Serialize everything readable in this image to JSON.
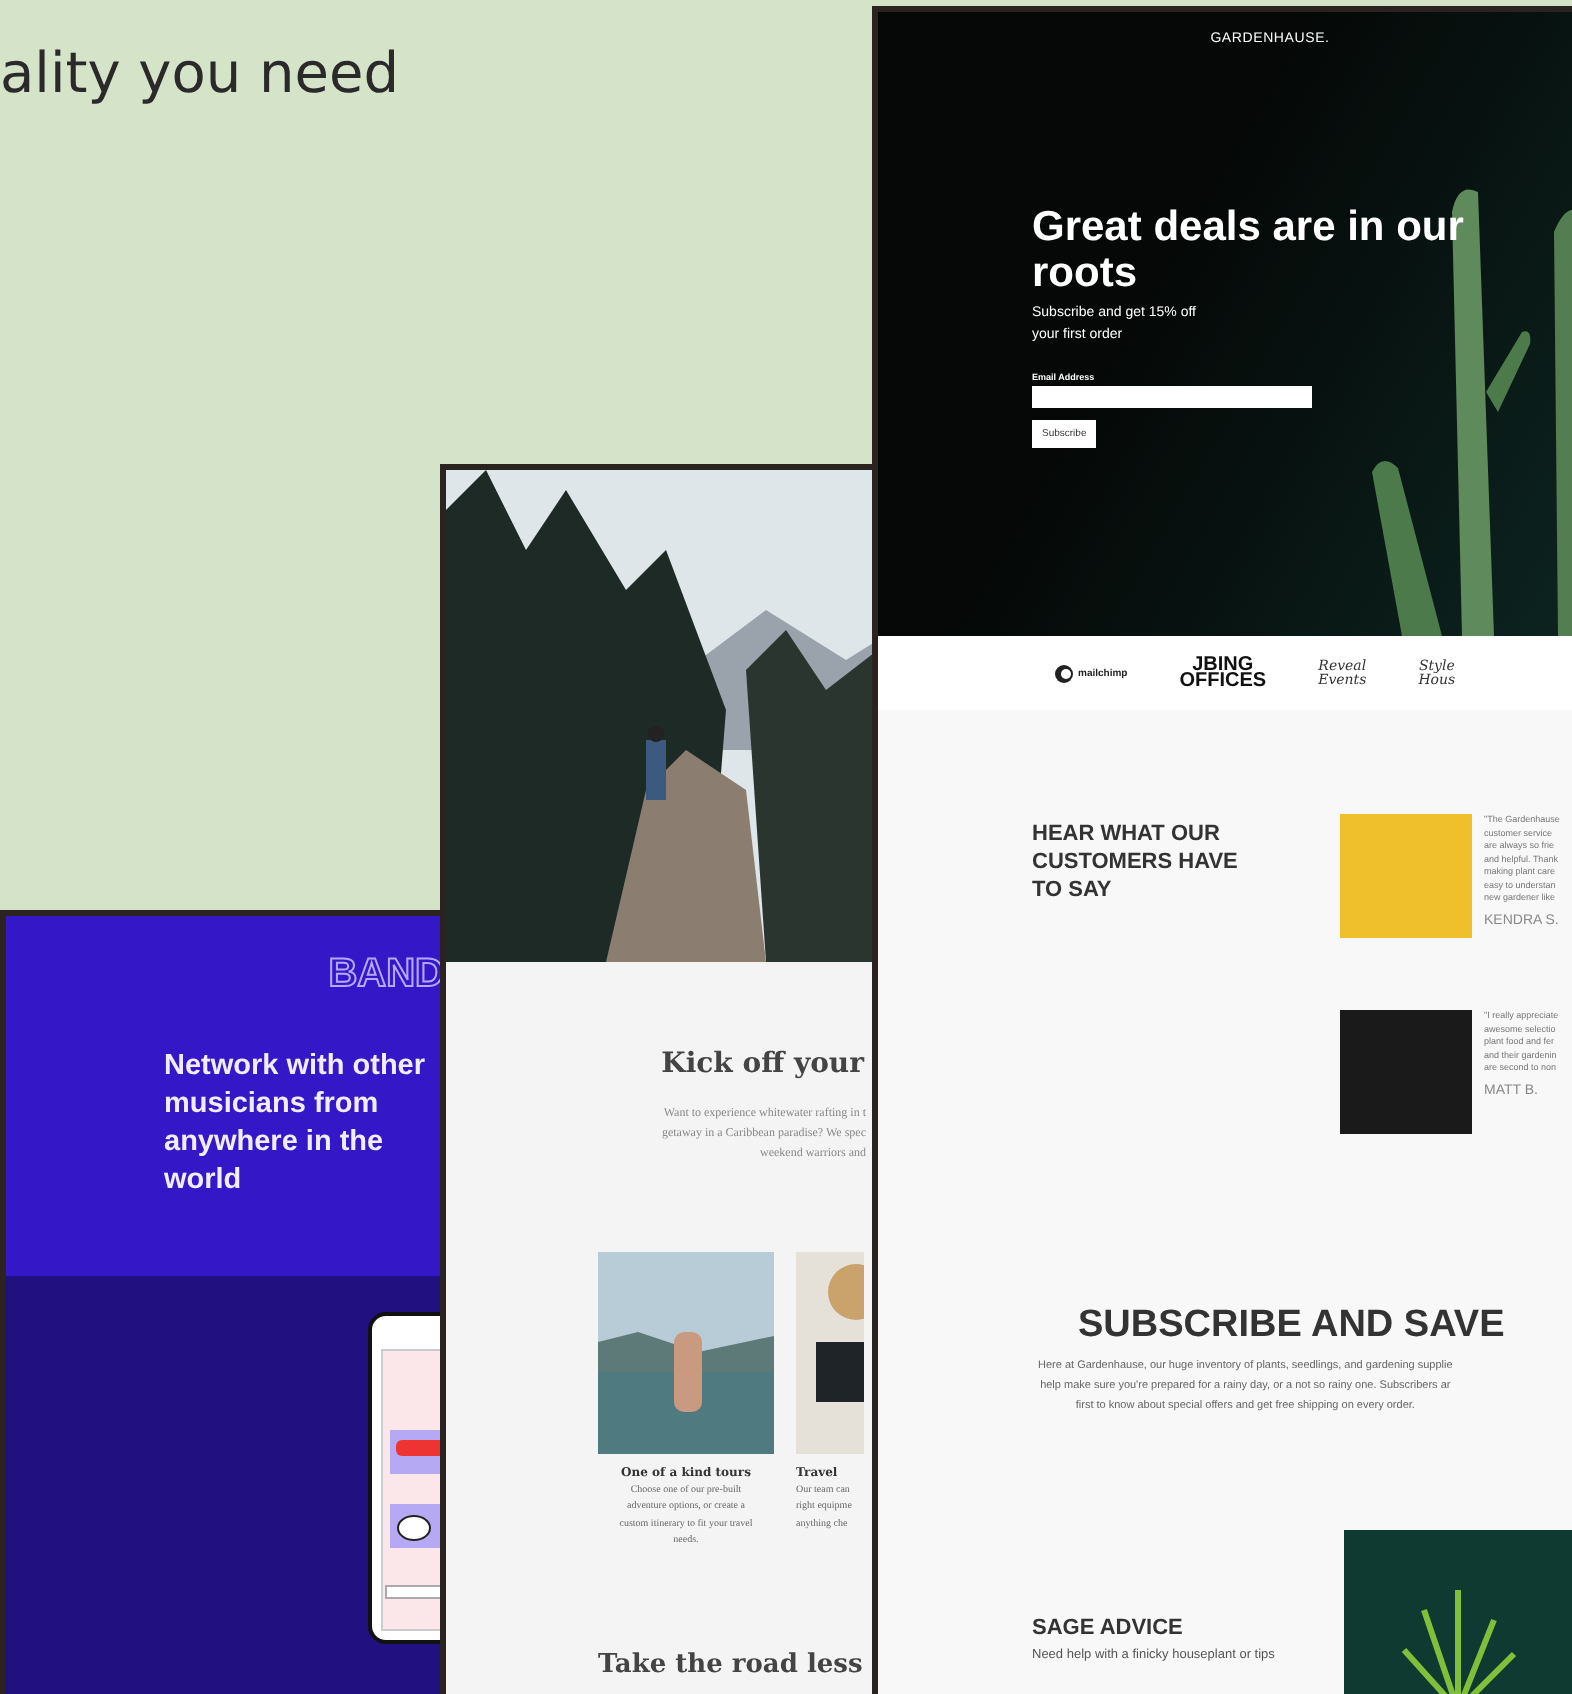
{
  "headline": "ality you need",
  "gardenhause": {
    "brand": "GARDENHAUSE.",
    "hero_title": "Great deals are in our roots",
    "hero_subtitle_lines": [
      "Subscribe and get 15% off",
      "your first order"
    ],
    "email_label": "Email Address",
    "subscribe_button": "Subscribe",
    "logos": [
      {
        "kind": "badge",
        "lines": [
          "mailchimp"
        ]
      },
      {
        "kind": "block",
        "lines": [
          "JBING",
          "OFFICES"
        ]
      },
      {
        "kind": "script",
        "lines": [
          "Reveal",
          "Events"
        ]
      },
      {
        "kind": "script",
        "lines": [
          "Style",
          "Hous"
        ]
      }
    ],
    "testimonials": {
      "title": "HEAR WHAT OUR CUSTOMERS HAVE TO SAY",
      "items": [
        {
          "color": "#f0c02c",
          "quote_lines": [
            "\"The Gardenhause",
            "customer service",
            "are always so frie",
            "and helpful. Thank",
            "making plant care",
            "easy to understan",
            "new gardener like"
          ],
          "name": "KENDRA S."
        },
        {
          "color": "#1b1a1a",
          "quote_lines": [
            "\"I really appreciate",
            "awesome selectio",
            "plant food and fer",
            "and their gardenin",
            "are second to non"
          ],
          "name": "MATT B."
        }
      ]
    },
    "subscribe": {
      "title": "SUBSCRIBE AND SAVE",
      "body_lines": [
        "Here at Gardenhause, our huge inventory of plants, seedlings, and gardening supplie",
        "help make sure you're prepared for a rainy day, or a not so rainy one. Subscribers ar",
        "first to know about special offers and get free shipping on every order."
      ]
    },
    "sage": {
      "title": "SAGE ADVICE",
      "body": "Need help with a finicky houseplant or tips"
    }
  },
  "travel": {
    "title": "Kick off your",
    "intro_lines": [
      "Want to experience whitewater rafting in t",
      "getaway in a Caribbean paradise? We spec",
      "weekend warriors and"
    ],
    "cards": [
      {
        "title": "One of a kind tours",
        "body_lines": [
          "Choose one of our pre-built",
          "adventure options, or create a",
          "custom itinerary to fit your travel",
          "needs."
        ]
      },
      {
        "title": "Travel",
        "body_lines": [
          "Our team can",
          "right equipme",
          "anything che"
        ]
      }
    ],
    "footer_title": "Take the road less"
  },
  "band": {
    "logo": "BAND",
    "title": "Network with other musicians from anywhere in the world"
  }
}
